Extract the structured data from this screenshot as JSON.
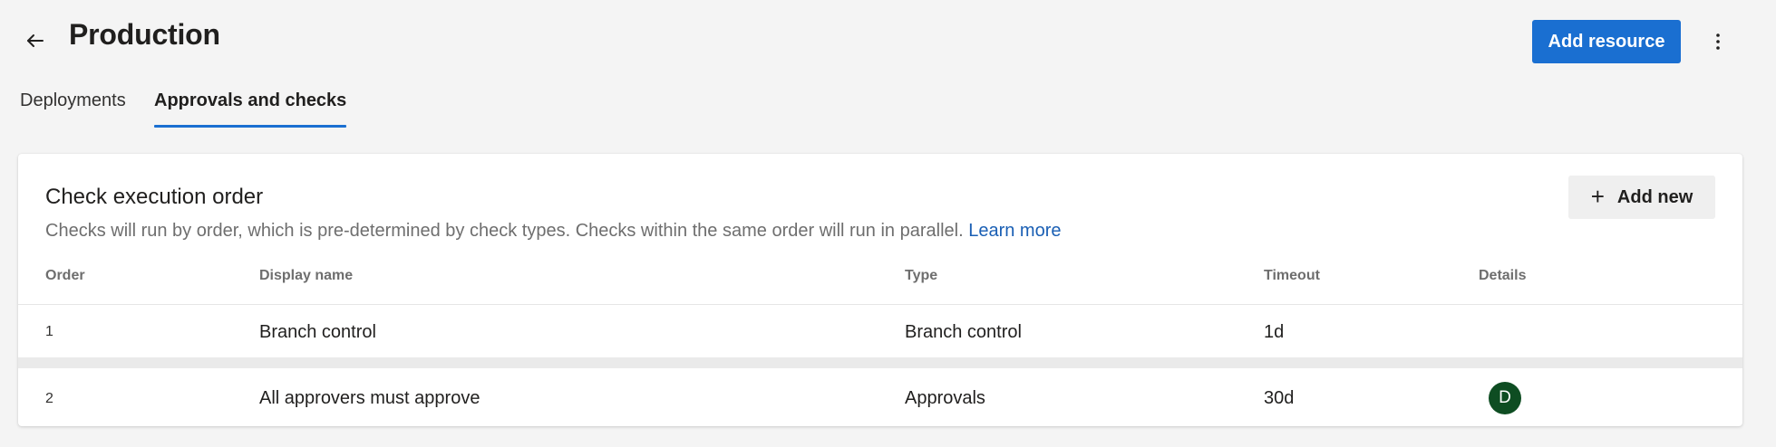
{
  "header": {
    "title": "Production",
    "add_resource_label": "Add resource"
  },
  "tabs": [
    {
      "label": "Deployments",
      "active": false
    },
    {
      "label": "Approvals and checks",
      "active": true
    }
  ],
  "card": {
    "title": "Check execution order",
    "description": "Checks will run by order, which is pre-determined by check types. Checks within the same order will run in parallel.",
    "learn_more": "Learn more",
    "add_new_label": "Add new",
    "columns": [
      "Order",
      "Display name",
      "Type",
      "Timeout",
      "Details"
    ],
    "rows": [
      {
        "order": "1",
        "display_name": "Branch control",
        "type": "Branch control",
        "timeout": "1d",
        "details": ""
      },
      {
        "order": "2",
        "display_name": "All approvers must approve",
        "type": "Approvals",
        "timeout": "30d",
        "details": "D"
      }
    ]
  },
  "icons": {
    "back": "arrow-left-icon",
    "more": "more-vertical-icon",
    "add": "plus-icon"
  },
  "colors": {
    "accent": "#1a6fd1",
    "link": "#1a5fb4",
    "avatar": "#0e4d22"
  }
}
